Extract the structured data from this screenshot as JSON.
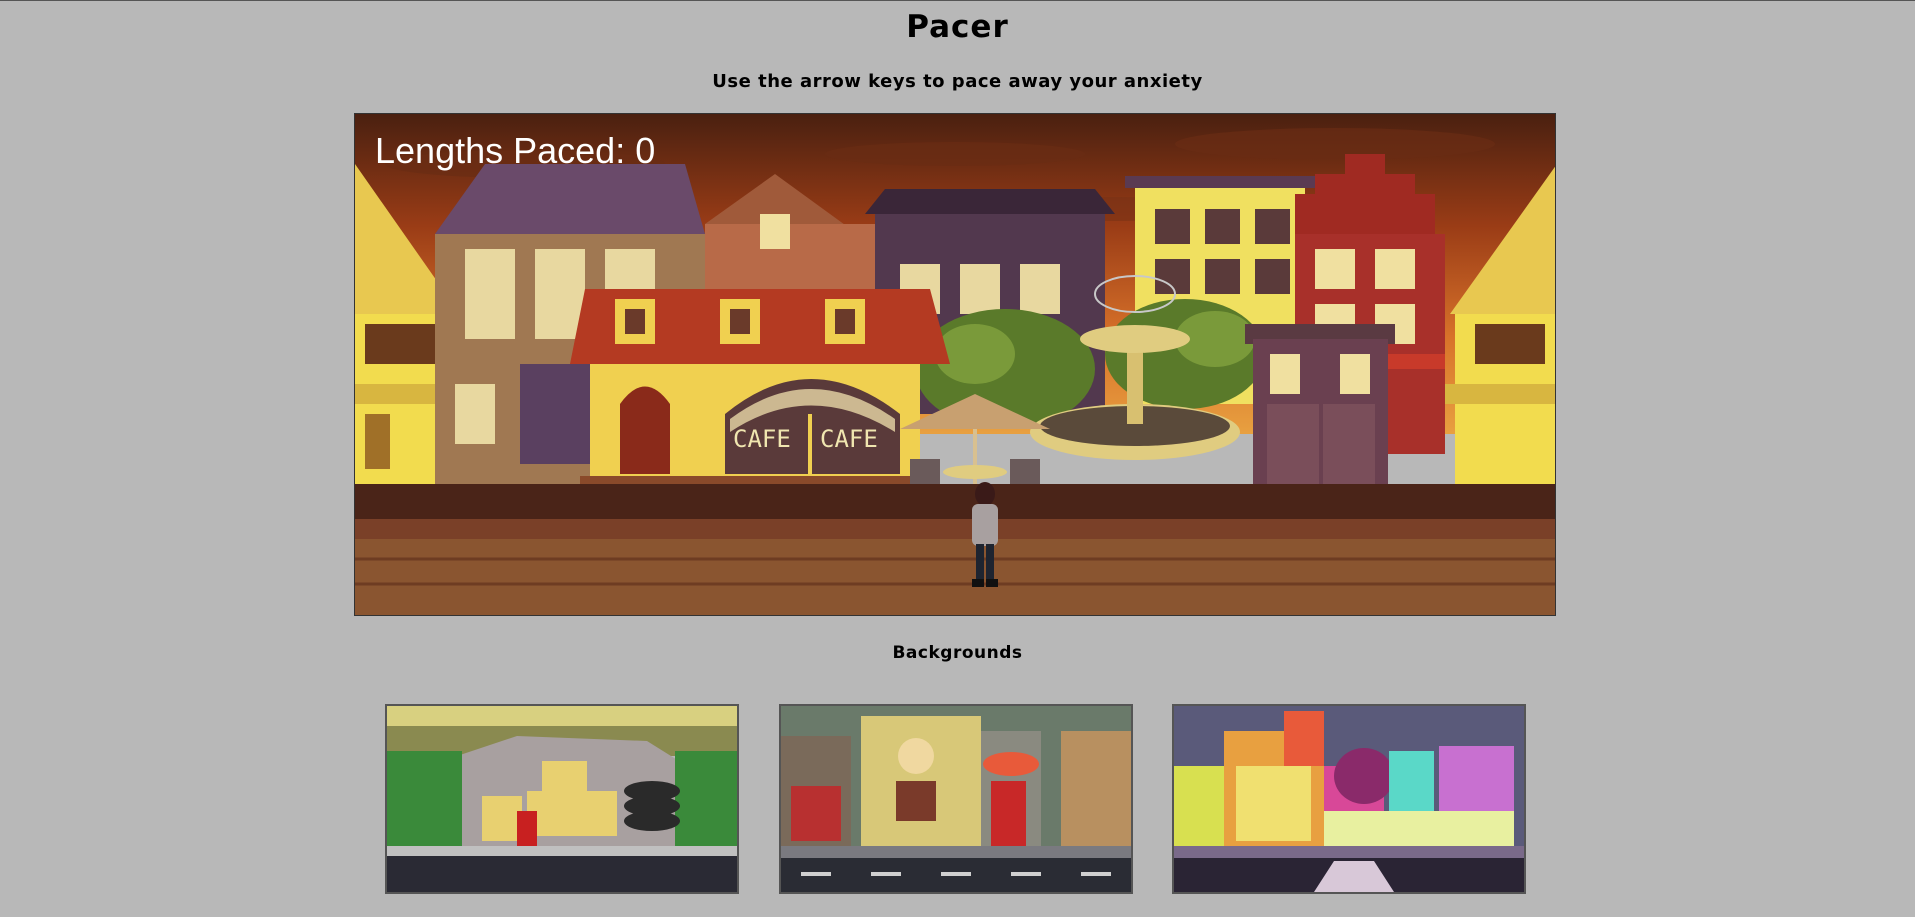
{
  "page": {
    "title": "Pacer",
    "subtitle": "Use the arrow keys to pace away your anxiety"
  },
  "game": {
    "score_label": "Lengths Paced: 0",
    "scene": "town-square",
    "sign_left": "CAFE",
    "sign_right": "CAFE"
  },
  "backgrounds": {
    "heading": "Backgrounds",
    "items": [
      {
        "name": "alley-scene",
        "sign": "",
        "selected": false
      },
      {
        "name": "street-scene",
        "sign": "",
        "selected": false
      },
      {
        "name": "neon-city-scene",
        "sign": "",
        "selected": false
      }
    ]
  },
  "colors": {
    "page_bg": "#b8b8b8",
    "sky_top": "#5a2a14",
    "sky_mid": "#b04a1a",
    "sky_low": "#e08a2a",
    "street": "#8a5530",
    "sidewalk": "#6e3c22"
  }
}
